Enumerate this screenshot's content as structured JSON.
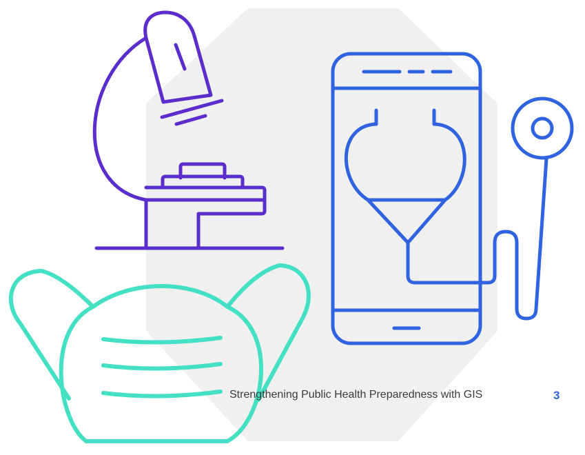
{
  "footer": {
    "title": "Strengthening Public Health Preparedness with GIS",
    "page_number": "3"
  },
  "illustration": {
    "icons": [
      "microscope-icon",
      "smartphone-stethoscope-icon",
      "face-mask-icon"
    ],
    "colors": {
      "background_shape": "#f0f0f0",
      "microscope": "#5a2dcc",
      "phone": "#2f63e0",
      "mask": "#43e0c3",
      "page_number": "#2f63e0"
    }
  }
}
